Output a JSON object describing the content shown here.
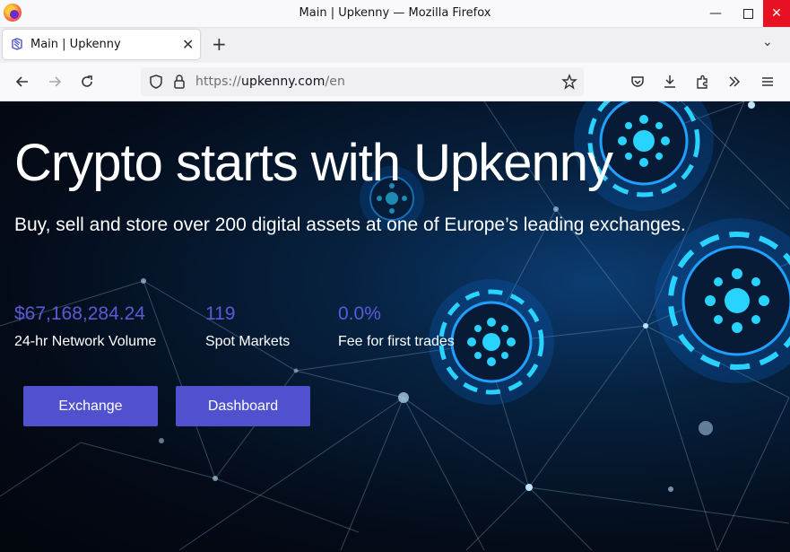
{
  "window": {
    "title": "Main | Upkenny — Mozilla Firefox",
    "controls": {
      "minimize": "—",
      "close": "✕"
    }
  },
  "tab": {
    "label": "Main | Upkenny",
    "close": "✕",
    "new_tab": "+",
    "list_tabs": "⌄"
  },
  "urlbar": {
    "scheme": "https://",
    "host": "upkenny.com",
    "path": "/en"
  },
  "hero": {
    "title": "Crypto starts with Upkenny",
    "subtitle": "Buy, sell and store over 200 digital assets at one of Europe’s leading exchanges."
  },
  "stats": [
    {
      "value": "$67,168,284.24",
      "label": "24-hr Network Volume"
    },
    {
      "value": "119",
      "label": "Spot Markets"
    },
    {
      "value": "0.0%",
      "label": "Fee for first trades"
    }
  ],
  "buttons": {
    "exchange": "Exchange",
    "dashboard": "Dashboard"
  },
  "colors": {
    "accent": "#5151cf",
    "stat_value": "#5b5bd6",
    "glow": "#29d3ff"
  }
}
